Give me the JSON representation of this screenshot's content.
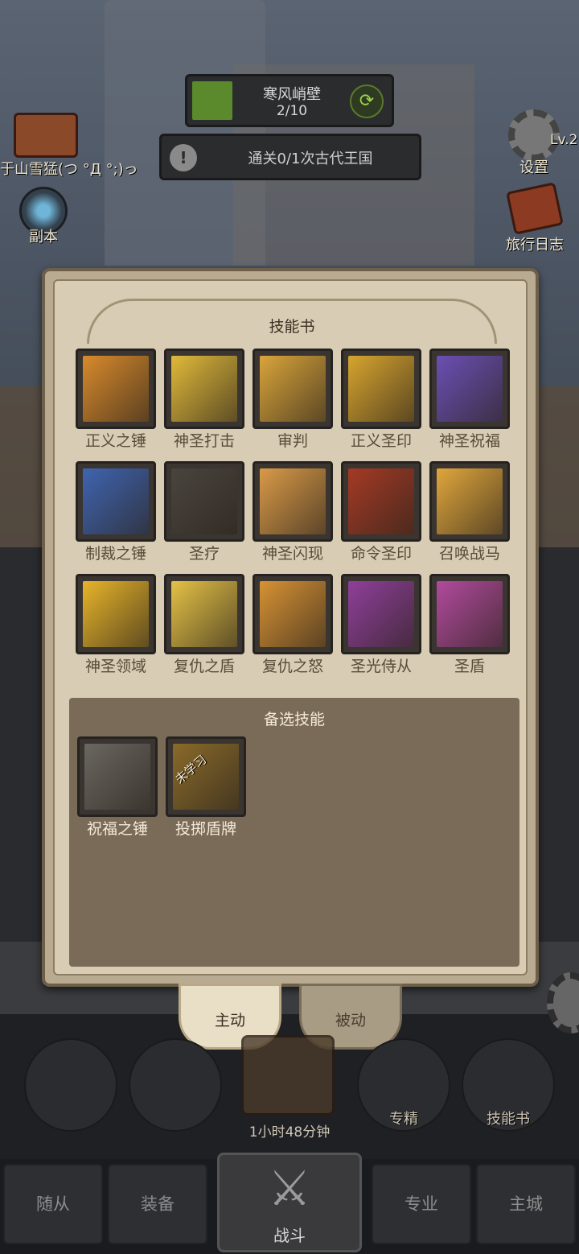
{
  "hud": {
    "quest": {
      "title": "寒风峭壁",
      "progress_text": "2/10",
      "progress": 0.2
    },
    "mission": {
      "text": "通关0/1次古代王国"
    },
    "player_name": "于山雪猛(つ °Д °;)っ",
    "dungeon_label": "副本",
    "settings_label": "设置",
    "level_text": "Lv.2",
    "journal_label": "旅行日志"
  },
  "skill_book": {
    "title": "技能书",
    "equipped": [
      {
        "name": "正义之锤",
        "icon": "hammer-icon",
        "color": "#d88a2c"
      },
      {
        "name": "神圣打击",
        "icon": "holy-strike-icon",
        "color": "#e0b93a"
      },
      {
        "name": "审判",
        "icon": "judgment-icon",
        "color": "#d9a43a"
      },
      {
        "name": "正义圣印",
        "icon": "seal-icon",
        "color": "#d7a42e"
      },
      {
        "name": "神圣祝福",
        "icon": "helmet-icon",
        "color": "#6b4fb3"
      },
      {
        "name": "制裁之锤",
        "icon": "sanction-hammer-icon",
        "color": "#3f64b0"
      },
      {
        "name": "圣疗",
        "icon": "heal-icon",
        "color": "#4a443e"
      },
      {
        "name": "神圣闪现",
        "icon": "flash-icon",
        "color": "#d99a48"
      },
      {
        "name": "命令圣印",
        "icon": "command-seal-icon",
        "color": "#a33a24"
      },
      {
        "name": "召唤战马",
        "icon": "horse-icon",
        "color": "#e0a63c"
      },
      {
        "name": "神圣领域",
        "icon": "crown-icon",
        "color": "#e7b42a"
      },
      {
        "name": "复仇之盾",
        "icon": "shield-icon",
        "color": "#e4c146"
      },
      {
        "name": "复仇之怒",
        "icon": "wrath-icon",
        "color": "#d79234"
      },
      {
        "name": "圣光侍从",
        "icon": "squire-icon",
        "color": "#8f3f9a"
      },
      {
        "name": "圣盾",
        "icon": "holy-shield-icon",
        "color": "#b14a9c"
      }
    ],
    "alternate_title": "备选技能",
    "alternate": [
      {
        "name": "祝福之锤",
        "icon": "blessing-hammer-icon",
        "color": "#6a6660",
        "badge": ""
      },
      {
        "name": "投掷盾牌",
        "icon": "throw-shield-icon",
        "color": "#8a6a2a",
        "badge": "未学习"
      }
    ],
    "tabs": {
      "active": "主动",
      "passive": "被动"
    }
  },
  "actions": {
    "specialize_label": "专精",
    "skillbook_label": "技能书",
    "timer_text": "1小时48分钟"
  },
  "nav": {
    "followers": "随从",
    "equipment": "装备",
    "battle": "战斗",
    "profession": "专业",
    "city": "主城"
  }
}
